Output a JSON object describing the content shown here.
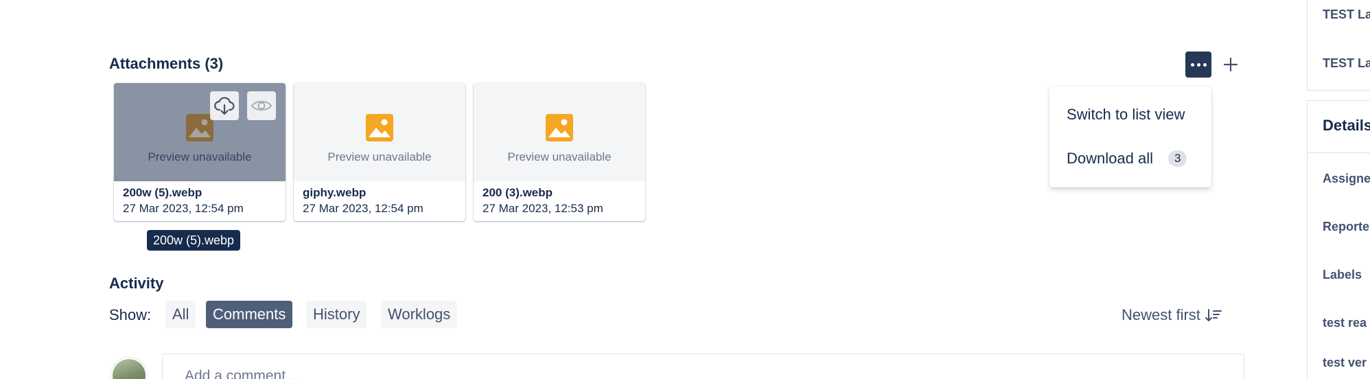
{
  "attachments": {
    "title": "Attachments (3)",
    "more_icon": "ellipsis-icon",
    "add_icon": "plus-icon",
    "items": [
      {
        "file_name": "200w (5).webp",
        "date": "27 Mar 2023, 12:54 pm",
        "preview_text": "Preview unavailable",
        "icon": "image-icon"
      },
      {
        "file_name": "giphy.webp",
        "date": "27 Mar 2023, 12:54 pm",
        "preview_text": "Preview unavailable",
        "icon": "image-icon"
      },
      {
        "file_name": "200 (3).webp",
        "date": "27 Mar 2023, 12:53 pm",
        "preview_text": "Preview unavailable",
        "icon": "image-icon"
      }
    ],
    "tooltip": "200w (5).webp",
    "menu": {
      "switch_view": "Switch to list view",
      "download_all": "Download all",
      "download_count": "3"
    }
  },
  "activity": {
    "title": "Activity",
    "show_label": "Show:",
    "filters": [
      "All",
      "Comments",
      "History",
      "Worklogs"
    ],
    "active_filter": "Comments",
    "sort_label": "Newest first",
    "comment_placeholder": "Add a comment…"
  },
  "right_panel": {
    "top_items": [
      "TEST La",
      "TEST La"
    ],
    "details_heading": "Details",
    "fields": [
      "Assigne",
      "Reporte",
      "Labels",
      "test rea",
      "test ver"
    ]
  },
  "colors": {
    "primary_text": "#172B4D",
    "active_filter_bg": "#505F79",
    "more_button_bg": "#253858",
    "image_icon": "#F5A623"
  }
}
